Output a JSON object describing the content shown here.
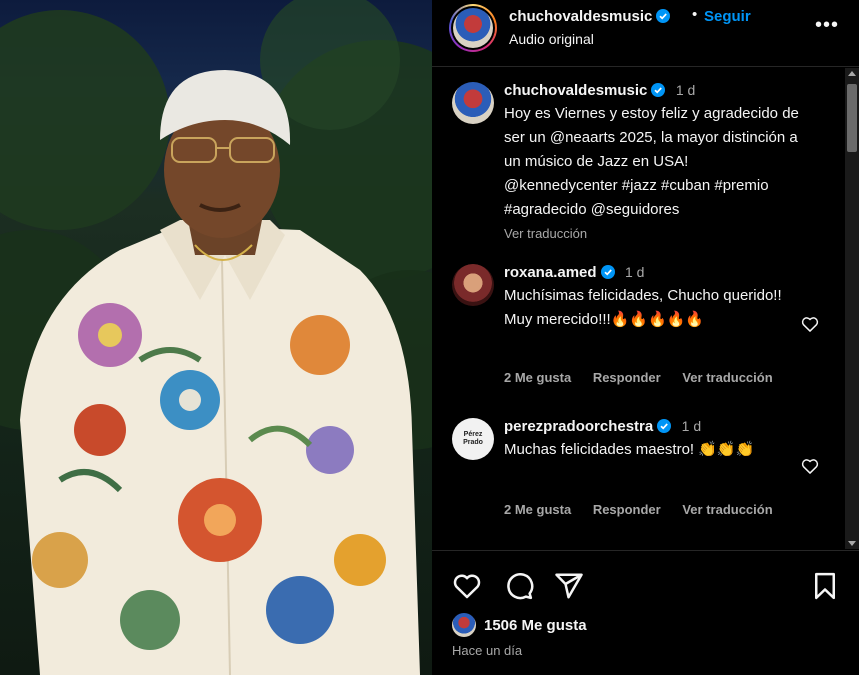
{
  "post": {
    "username": "chuchovaldesmusic",
    "follow_label": "Seguir",
    "separator": "•",
    "audio_label": "Audio original",
    "more_label": "•••"
  },
  "caption": {
    "username": "chuchovaldesmusic",
    "time": "1 d",
    "text": "Hoy es Viernes y estoy feliz y agradecido de ser un @neaarts 2025, la mayor distinción a un músico de Jazz en USA! @kennedycenter #jazz #cuban #premio #agradecido @seguidores",
    "translate_label": "Ver traducción"
  },
  "comments": [
    {
      "username": "roxana.amed",
      "time": "1 d",
      "text": "Muchísimas felicidades, Chucho querido!! Muy merecido!!!🔥🔥🔥🔥🔥",
      "likes": "2 Me gusta",
      "reply_label": "Responder",
      "translate_label": "Ver traducción"
    },
    {
      "username": "perezpradoorchestra",
      "time": "1 d",
      "text": "Muchas felicidades maestro! 👏👏👏",
      "likes": "2 Me gusta",
      "reply_label": "Responder",
      "translate_label": "Ver traducción",
      "avatar_text": "Pérez Prado"
    }
  ],
  "footer": {
    "likes": "1506 Me gusta",
    "time_ago": "Hace un día"
  },
  "icons": [
    "heart-icon",
    "comment-icon",
    "share-icon",
    "bookmark-icon",
    "more-icon",
    "verified-icon"
  ],
  "colors": {
    "link": "#0095f6",
    "verified": "#0095f6",
    "background": "#000000",
    "muted": "#a8a8a8"
  }
}
